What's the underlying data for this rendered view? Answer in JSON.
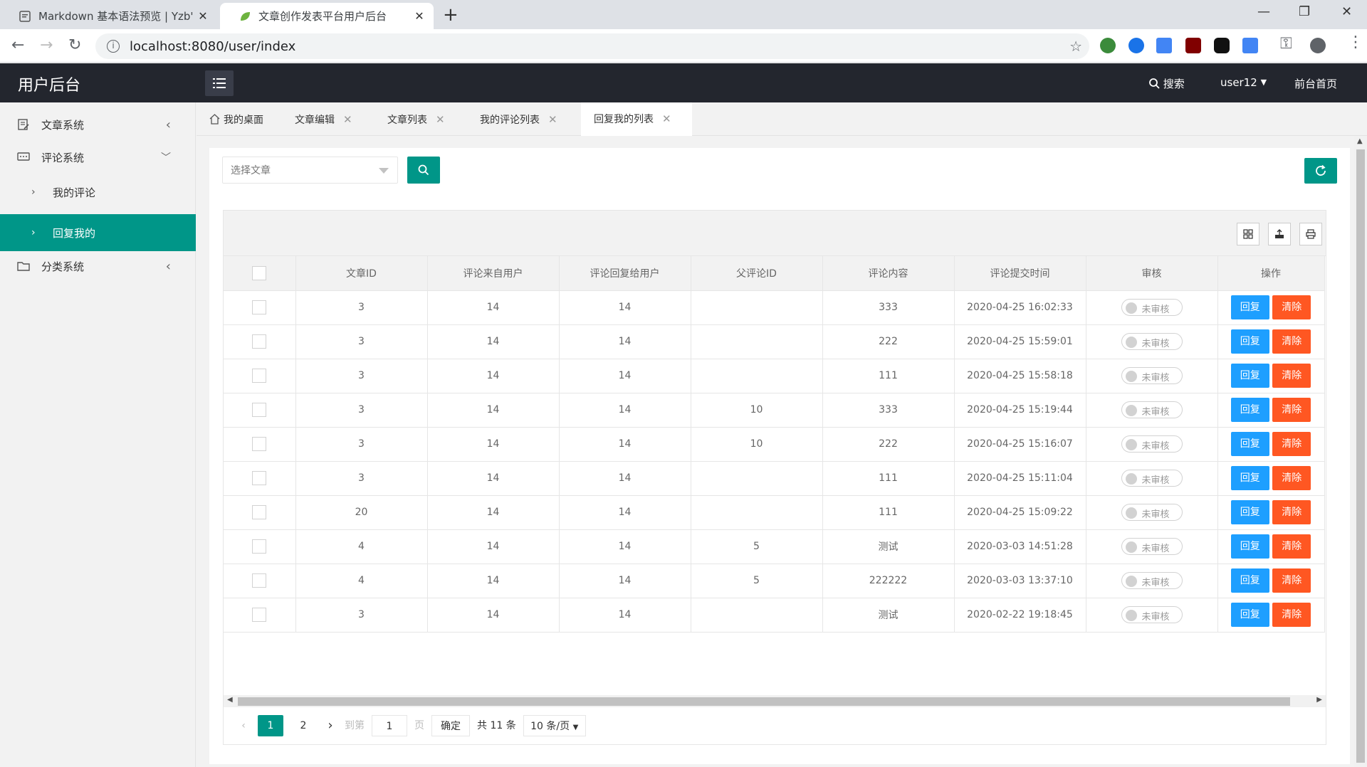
{
  "browser": {
    "tabs": [
      {
        "title": "Markdown 基本语法预览 | Yzb'",
        "active": false
      },
      {
        "title": "文章创作发表平台用户后台",
        "active": true
      }
    ],
    "url": "localhost:8080/user/index"
  },
  "header": {
    "app_title": "用户后台",
    "search_label": "搜索",
    "username": "user12",
    "home_link": "前台首页"
  },
  "sidebar": {
    "items": [
      {
        "label": "文章系统",
        "icon": "edit-icon"
      },
      {
        "label": "评论系统",
        "icon": "comment-icon"
      },
      {
        "label": "我的评论"
      },
      {
        "label": "回复我的"
      },
      {
        "label": "分类系统",
        "icon": "folder-icon"
      }
    ]
  },
  "page_tabs": [
    {
      "label": "我的桌面"
    },
    {
      "label": "文章编辑"
    },
    {
      "label": "文章列表"
    },
    {
      "label": "我的评论列表"
    },
    {
      "label": "回复我的列表",
      "active": true
    }
  ],
  "filter": {
    "placeholder": "选择文章"
  },
  "table": {
    "columns": [
      "文章ID",
      "评论来自用户",
      "评论回复给用户",
      "父评论ID",
      "评论内容",
      "评论提交时间",
      "审核",
      "操作"
    ],
    "rows": [
      {
        "article_id": "3",
        "from_user": "14",
        "to_user": "14",
        "parent_id": "",
        "content": "333",
        "time": "2020-04-25 16:02:33",
        "status": "未审核"
      },
      {
        "article_id": "3",
        "from_user": "14",
        "to_user": "14",
        "parent_id": "",
        "content": "222",
        "time": "2020-04-25 15:59:01",
        "status": "未审核"
      },
      {
        "article_id": "3",
        "from_user": "14",
        "to_user": "14",
        "parent_id": "",
        "content": "111",
        "time": "2020-04-25 15:58:18",
        "status": "未审核"
      },
      {
        "article_id": "3",
        "from_user": "14",
        "to_user": "14",
        "parent_id": "10",
        "content": "333",
        "time": "2020-04-25 15:19:44",
        "status": "未审核"
      },
      {
        "article_id": "3",
        "from_user": "14",
        "to_user": "14",
        "parent_id": "10",
        "content": "222",
        "time": "2020-04-25 15:16:07",
        "status": "未审核"
      },
      {
        "article_id": "3",
        "from_user": "14",
        "to_user": "14",
        "parent_id": "",
        "content": "111",
        "time": "2020-04-25 15:11:04",
        "status": "未审核"
      },
      {
        "article_id": "20",
        "from_user": "14",
        "to_user": "14",
        "parent_id": "",
        "content": "111",
        "time": "2020-04-25 15:09:22",
        "status": "未审核"
      },
      {
        "article_id": "4",
        "from_user": "14",
        "to_user": "14",
        "parent_id": "5",
        "content": "测试",
        "time": "2020-03-03 14:51:28",
        "status": "未审核"
      },
      {
        "article_id": "4",
        "from_user": "14",
        "to_user": "14",
        "parent_id": "5",
        "content": "222222",
        "time": "2020-03-03 13:37:10",
        "status": "未审核"
      },
      {
        "article_id": "3",
        "from_user": "14",
        "to_user": "14",
        "parent_id": "",
        "content": "测试",
        "time": "2020-02-22 19:18:45",
        "status": "未审核"
      }
    ],
    "reply_label": "回复",
    "delete_label": "清除"
  },
  "pager": {
    "pages": [
      "1",
      "2"
    ],
    "current": "1",
    "goto_label": "到第",
    "goto_value": "1",
    "page_unit": "页",
    "confirm_label": "确定",
    "total_label": "共 11 条",
    "page_size": "10 条/页"
  },
  "colors": {
    "primary": "#009688",
    "header_bg": "#23262e",
    "reply_btn": "#1e9fff",
    "delete_btn": "#ff5722"
  }
}
